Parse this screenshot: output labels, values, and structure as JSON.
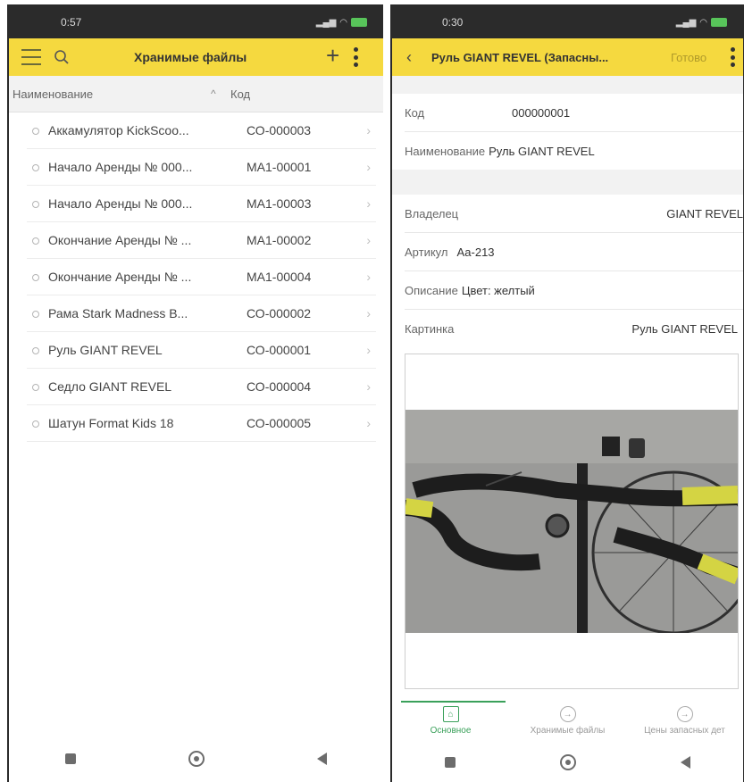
{
  "left": {
    "status": {
      "time": "0:57"
    },
    "appbar": {
      "title": "Хранимые файлы"
    },
    "list": {
      "headers": {
        "name": "Наименование",
        "code": "Код"
      },
      "rows": [
        {
          "name": "Аккамулятор KickScoo...",
          "code": "СО-000003"
        },
        {
          "name": "Начало Аренды № 000...",
          "code": "МА1-00001"
        },
        {
          "name": "Начало Аренды № 000...",
          "code": "МА1-00003"
        },
        {
          "name": "Окончание Аренды № ...",
          "code": "МА1-00002"
        },
        {
          "name": "Окончание Аренды № ...",
          "code": "МА1-00004"
        },
        {
          "name": "Рама Stark Madness B...",
          "code": "СО-000002"
        },
        {
          "name": "Руль GIANT REVEL",
          "code": "СО-000001"
        },
        {
          "name": "Седло GIANT REVEL",
          "code": "СО-000004"
        },
        {
          "name": "Шатун Format Kids 18",
          "code": "СО-000005"
        }
      ]
    }
  },
  "right": {
    "status": {
      "time": "0:30"
    },
    "appbar": {
      "title": "Руль GIANT REVEL (Запасны...",
      "done_label": "Готово"
    },
    "fields": {
      "code_label": "Код",
      "code_value": "000000001",
      "name_label": "Наименование",
      "name_value": "Руль GIANT REVEL",
      "owner_label": "Владелец",
      "owner_value": "GIANT REVEL",
      "article_label": "Артикул",
      "article_value": "Аа-213",
      "desc_label": "Описание",
      "desc_value": "Цвет: желтый",
      "picture_label": "Картинка",
      "picture_value": "Руль GIANT REVEL"
    },
    "tabs": [
      {
        "label": "Основное"
      },
      {
        "label": "Хранимые файлы"
      },
      {
        "label": "Цены запасных дет"
      }
    ]
  },
  "colors": {
    "appbar": "#f5d93f",
    "active_tab": "#3aa05a",
    "statusbar": "#2b2b2b"
  }
}
